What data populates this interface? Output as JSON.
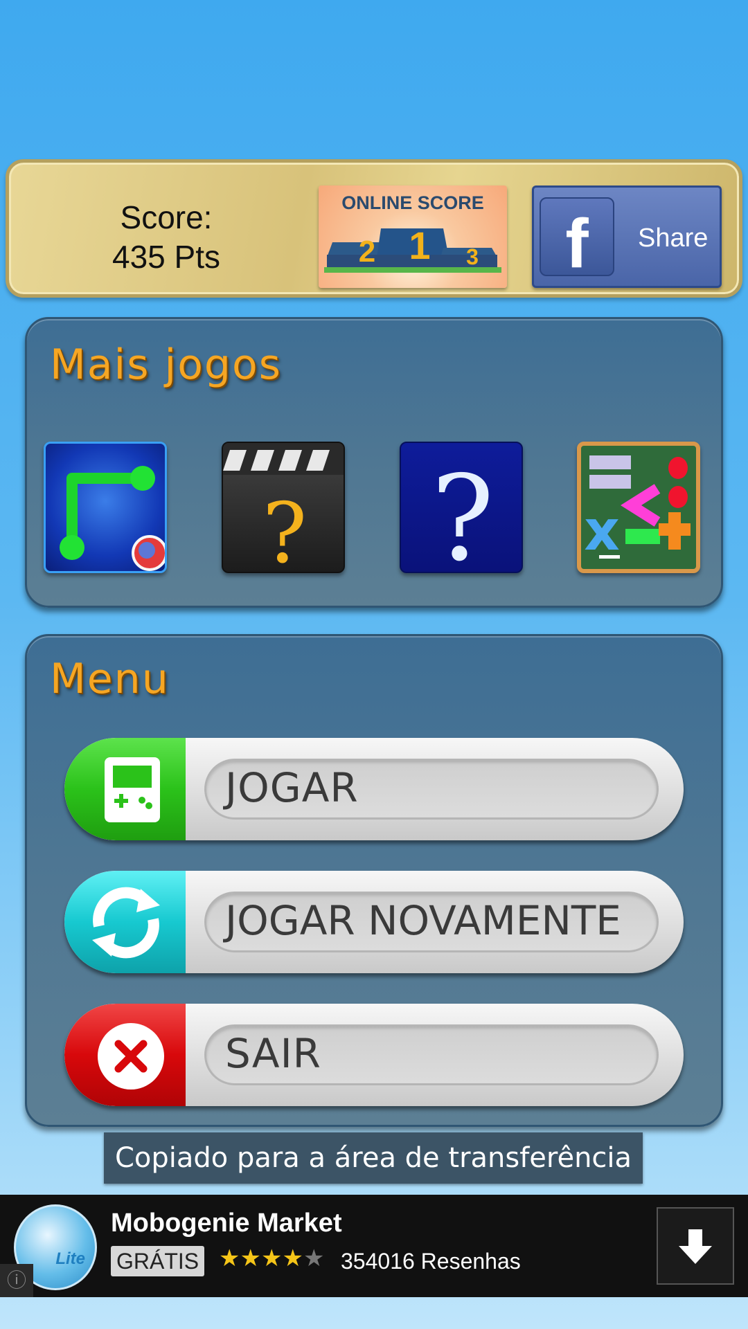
{
  "score": {
    "label": "Score:",
    "value": "435 Pts",
    "online_score_label": "ONLINE SCORE",
    "podium_numbers": [
      "2",
      "1",
      "3"
    ],
    "share_label": "Share",
    "facebook_letter": "f"
  },
  "more_games": {
    "title": "Mais jogos",
    "icons": [
      "connect-dots-game-icon",
      "movie-quiz-game-icon",
      "quiz-game-icon",
      "math-game-icon"
    ]
  },
  "menu": {
    "title": "Menu",
    "buttons": [
      {
        "label": "JOGAR",
        "icon": "gamepad-icon",
        "color": "#2bc21a"
      },
      {
        "label": "JOGAR NOVAMENTE",
        "icon": "refresh-icon",
        "color": "#17c9d0"
      },
      {
        "label": "SAIR",
        "icon": "close-icon",
        "color": "#d8080b"
      }
    ]
  },
  "toast": {
    "text": "Copiado para a área de transferência"
  },
  "ad": {
    "title": "Mobogenie Market",
    "badge": "GRÁTIS",
    "rating": 4,
    "rating_max": 5,
    "reviews": "354016 Resenhas",
    "logo_text": "Lite"
  }
}
